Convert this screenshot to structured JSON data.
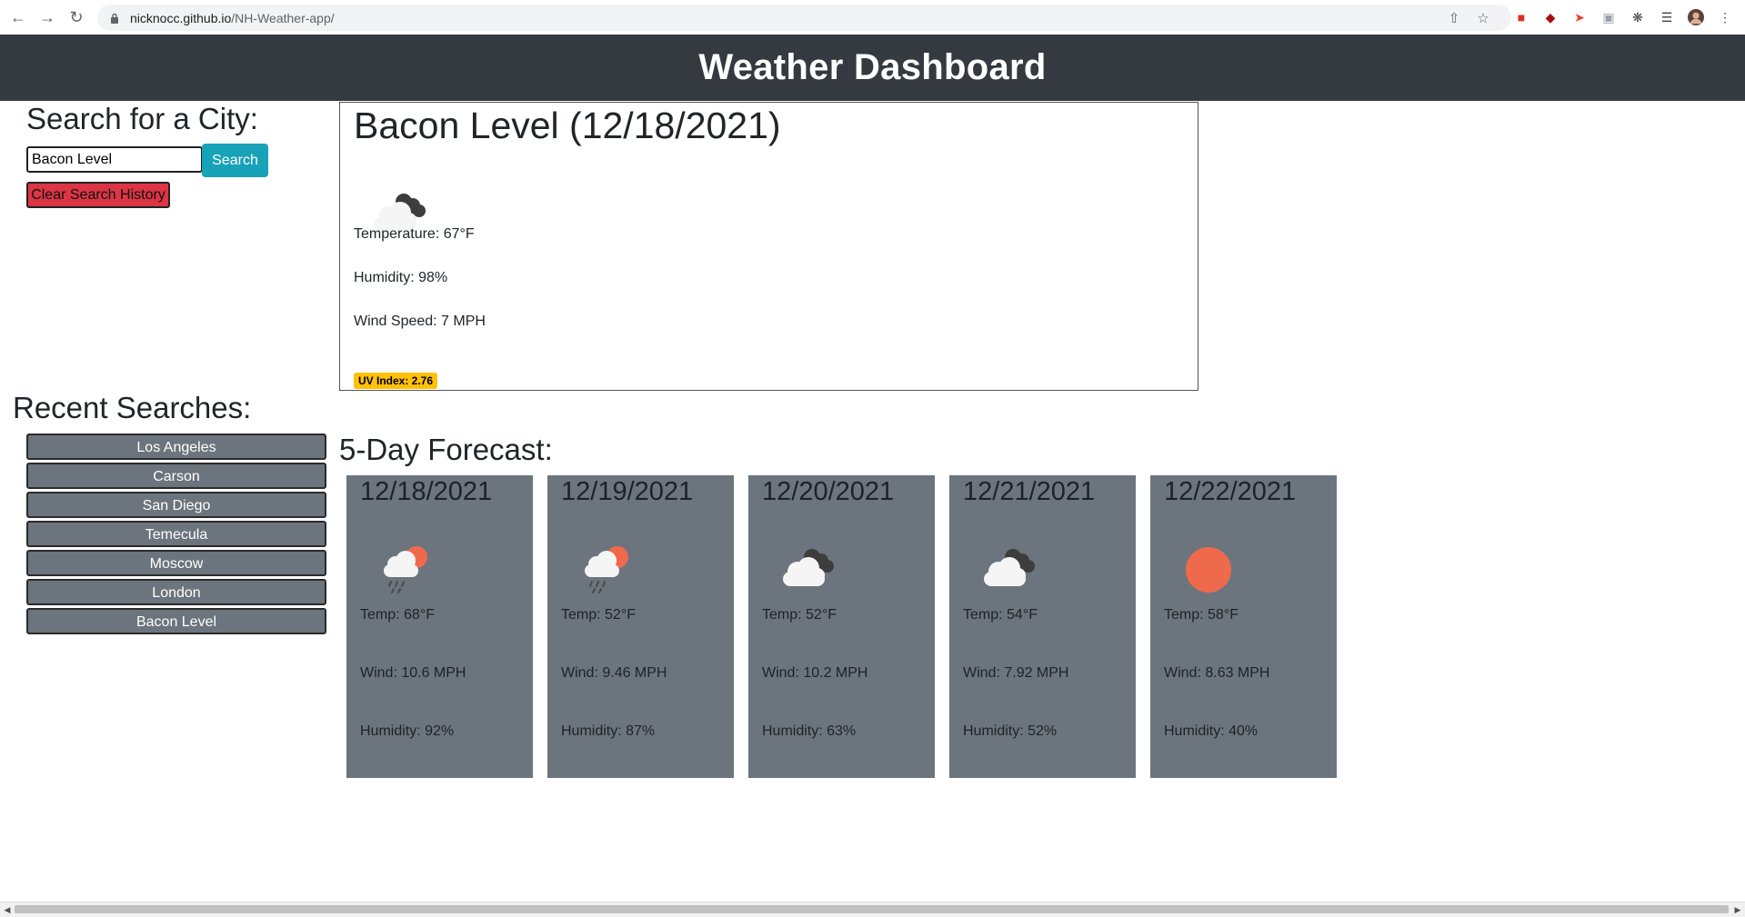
{
  "browser": {
    "url_host": "nicknocc.github.io",
    "url_path": "/NH-Weather-app/"
  },
  "header": {
    "title": "Weather Dashboard"
  },
  "search": {
    "heading": "Search for a City:",
    "input_value": "Bacon Level",
    "search_label": "Search",
    "clear_label": "Clear Search History"
  },
  "recent": {
    "heading": "Recent Searches:",
    "items": [
      "Los Angeles",
      "Carson",
      "San Diego",
      "Temecula",
      "Moscow",
      "London",
      "Bacon Level"
    ]
  },
  "current": {
    "title": "Bacon Level (12/18/2021)",
    "icon": "cloudy-icon",
    "temperature": "Temperature: 67°F",
    "humidity": "Humidity: 98%",
    "wind": "Wind Speed: 7 MPH",
    "uv": "UV Index: 2.76"
  },
  "forecast": {
    "heading": "5-Day Forecast:",
    "days": [
      {
        "date": "12/18/2021",
        "icon": "rain-sun-icon",
        "temp": "Temp: 68°F",
        "wind": "Wind: 10.6 MPH",
        "humidity": "Humidity: 92%"
      },
      {
        "date": "12/19/2021",
        "icon": "rain-sun-icon",
        "temp": "Temp: 52°F",
        "wind": "Wind: 9.46 MPH",
        "humidity": "Humidity: 87%"
      },
      {
        "date": "12/20/2021",
        "icon": "cloudy-icon",
        "temp": "Temp: 52°F",
        "wind": "Wind: 10.2 MPH",
        "humidity": "Humidity: 63%"
      },
      {
        "date": "12/21/2021",
        "icon": "cloudy-icon",
        "temp": "Temp: 54°F",
        "wind": "Wind: 7.92 MPH",
        "humidity": "Humidity: 52%"
      },
      {
        "date": "12/22/2021",
        "icon": "sun-icon",
        "temp": "Temp: 58°F",
        "wind": "Wind: 8.63 MPH",
        "humidity": "Humidity: 40%"
      }
    ]
  },
  "colors": {
    "header_bg": "#343a40",
    "card_bg": "#6c757d",
    "search_btn": "#17a2b8",
    "clear_btn": "#dc3545",
    "uv_badge": "#ffc107",
    "sun": "#ef6a4c"
  }
}
